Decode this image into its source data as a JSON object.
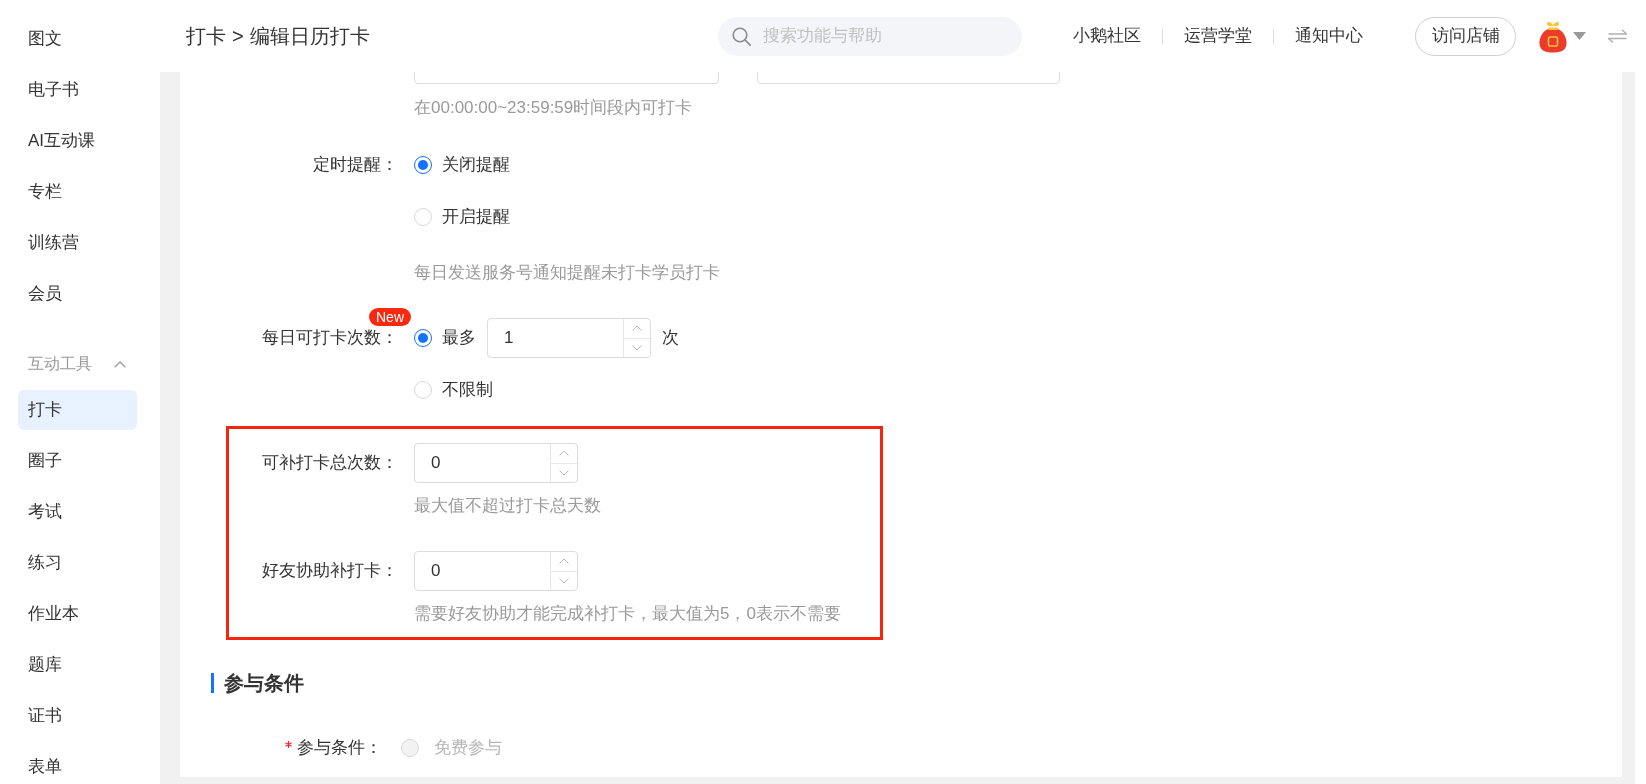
{
  "sidebar": {
    "items": [
      {
        "label": "图文",
        "selected": false
      },
      {
        "label": "电子书",
        "selected": false
      },
      {
        "label": "AI互动课",
        "selected": false
      },
      {
        "label": "专栏",
        "selected": false
      },
      {
        "label": "训练营",
        "selected": false
      },
      {
        "label": "会员",
        "selected": false
      }
    ],
    "groups": [
      {
        "label": "互动工具",
        "expanded": true,
        "items": [
          {
            "label": "打卡",
            "selected": true
          },
          {
            "label": "圈子",
            "selected": false
          },
          {
            "label": "考试",
            "selected": false
          },
          {
            "label": "练习",
            "selected": false
          },
          {
            "label": "作业本",
            "selected": false
          },
          {
            "label": "题库",
            "selected": false
          },
          {
            "label": "证书",
            "selected": false
          },
          {
            "label": "表单",
            "selected": false
          }
        ]
      }
    ]
  },
  "header": {
    "breadcrumb": {
      "items": [
        "打卡",
        "编辑日历打卡"
      ],
      "separator": ">"
    },
    "search": {
      "placeholder": "搜索功能与帮助"
    },
    "links": [
      "小鹅社区",
      "运营学堂",
      "通知中心"
    ],
    "visit_store_button": "访问店铺"
  },
  "form": {
    "time_range_hint": "在00:00:00~23:59:59时间段内可打卡",
    "radio_groups": [
      {
        "label": "定时提醒：",
        "options": [
          {
            "label": "关闭提醒",
            "selected": true
          },
          {
            "label": "开启提醒",
            "selected": false
          }
        ],
        "hint": "每日发送服务号通知提醒未打卡学员打卡"
      },
      {
        "label": "每日可打卡次数：",
        "badge": "New",
        "options": [
          {
            "label": "最多",
            "selected": true,
            "stepper": {
              "value": "1",
              "unit": "次"
            }
          },
          {
            "label": "不限制",
            "selected": false
          }
        ]
      }
    ],
    "highlighted_fields": [
      {
        "label": "可补打卡总次数：",
        "value": "0",
        "hint": "最大值不超过打卡总天数"
      },
      {
        "label": "好友协助补打卡：",
        "value": "0",
        "hint": "需要好友协助才能完成补打卡，最大值为5，0表示不需要"
      }
    ]
  },
  "participation": {
    "title": "参与条件",
    "fields": [
      {
        "label": "参与条件：",
        "required": true,
        "options": [
          {
            "label": "免费参与",
            "selected": false,
            "disabled": true
          }
        ]
      }
    ]
  }
}
